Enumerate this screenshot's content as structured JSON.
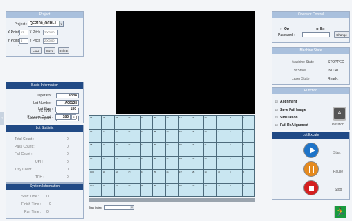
{
  "project_panel": {
    "header": "Project",
    "project_label": "Project :",
    "project_value": "QFP100_OCHI-1",
    "xpoint_label": "X Point :",
    "xpoint_value": "13",
    "xpitch_label": "X Pitch :",
    "xpitch_value": "2000.00",
    "ypoint_label": "Y Point :",
    "ypoint_value": "6",
    "ypitch_label": "Y Pitch :",
    "ypitch_value": "2000.00",
    "load_label": "Load",
    "save_label": "Save",
    "delete_label": "Delete"
  },
  "basic_info": {
    "header": "Basic Information",
    "fields": [
      {
        "label": "Operator :",
        "value": "ando"
      },
      {
        "label": "Lot Number :",
        "value": "A00128"
      },
      {
        "label": "IC Type :",
        "value": "QFP100"
      },
      {
        "label": "Laser Program :",
        "value": "13"
      },
      {
        "label": "Lot Size :",
        "value": "180"
      },
      {
        "label": "Program Count :",
        "value": "180"
      }
    ]
  },
  "lot_statistic": {
    "header": "Lot Statistic",
    "rows": [
      {
        "label": "Total Count :",
        "value": "0"
      },
      {
        "label": "Pass Count :",
        "value": "0"
      },
      {
        "label": "Fail Count :",
        "value": "0"
      },
      {
        "label": "UPH :",
        "value": "0"
      },
      {
        "label": "Tray Count :",
        "value": "0"
      },
      {
        "label": "TPH :",
        "value": "0"
      }
    ]
  },
  "system_info": {
    "header": "System Information",
    "rows": [
      {
        "label": "Start Time :",
        "value": "0"
      },
      {
        "label": "Finish Time :",
        "value": "0"
      },
      {
        "label": "Run Time :",
        "value": "0"
      }
    ]
  },
  "tray_grid": {
    "rows": [
      [
        "96",
        "95",
        "78",
        "77",
        "60",
        "59",
        "42",
        "41",
        "24",
        "23",
        "6",
        "5",
        "1"
      ],
      [
        "97",
        "94",
        "79",
        "76",
        "61",
        "58",
        "43",
        "40",
        "25",
        "22",
        "7",
        "4",
        "2"
      ],
      [
        "98",
        "93",
        "80",
        "75",
        "62",
        "57",
        "44",
        "39",
        "26",
        "21",
        "8",
        "3",
        "3"
      ],
      [
        "99",
        "92",
        "81",
        "74",
        "63",
        "56",
        "45",
        "38",
        "27",
        "20",
        "9",
        "2",
        "4"
      ],
      [
        "100",
        "91",
        "82",
        "73",
        "64",
        "55",
        "46",
        "37",
        "28",
        "19",
        "10",
        "1",
        "5"
      ],
      [
        "101",
        "90",
        "83",
        "72",
        "65",
        "54",
        "47",
        "36",
        "29",
        "18",
        "11",
        "0",
        "6"
      ]
    ],
    "tray_index_label": "Tray Index"
  },
  "operator_panel": {
    "header": "Operator Control",
    "op_label": "Op",
    "en_label": "En",
    "password_label": "Password :",
    "change_label": "Change"
  },
  "machine_status": {
    "header": "Machine State",
    "rows": [
      {
        "label": "Machine State",
        "value": "STOPPED"
      },
      {
        "label": "Lot State",
        "value": "INITIAL"
      },
      {
        "label": "Laser State",
        "value": "Ready."
      }
    ]
  },
  "function_panel": {
    "header": "Function",
    "options": [
      "Alignment",
      "Save Fail Image",
      "Simulation",
      "Fail ReAlignment"
    ],
    "position_label": "Position"
  },
  "lot_execute": {
    "header": "Lot Excute",
    "start_label": "Start",
    "pause_label": "Pause",
    "stop_label": "Stop"
  },
  "colors": {
    "accent": "#214a85",
    "start": "#1e74c8",
    "pause": "#e58a1e",
    "stop": "#d42020",
    "exit": "#1a9b3e"
  }
}
